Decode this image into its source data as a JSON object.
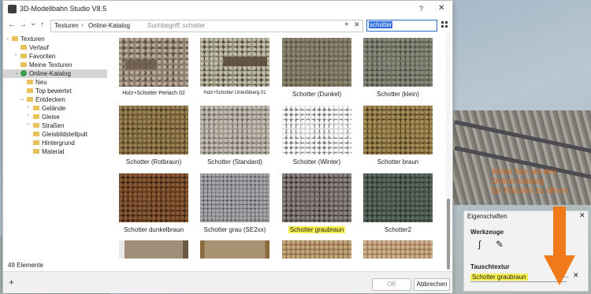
{
  "window": {
    "title": "3D-Modellbahn Studio V8.5",
    "help": "?",
    "close": "✕"
  },
  "toolbar": {
    "back": "←",
    "forward": "→",
    "dropdown": "⌄",
    "up": "↑",
    "breadcrumb": [
      "Texturen",
      "Online-Katalog"
    ],
    "separator": "›",
    "search_hint": "Suchbegriff: schotter",
    "add": "+",
    "clear": "✕",
    "search_value": "schotter"
  },
  "tree": {
    "items": [
      {
        "label": "Texturen",
        "level": 0,
        "expander": "⌄"
      },
      {
        "label": "Verlauf",
        "level": 1,
        "expander": ""
      },
      {
        "label": "Favoriten",
        "level": 1,
        "expander": "›"
      },
      {
        "label": "Meine Texturen",
        "level": 1,
        "expander": ""
      },
      {
        "label": "Online-Katalog",
        "level": 1,
        "expander": "⌄",
        "selected": true
      },
      {
        "label": "Neu",
        "level": 2,
        "expander": ""
      },
      {
        "label": "Top bewertet",
        "level": 2,
        "expander": ""
      },
      {
        "label": "Entdecken",
        "level": 2,
        "expander": "⌄"
      },
      {
        "label": "Gelände",
        "level": 3,
        "expander": "›"
      },
      {
        "label": "Gleise",
        "level": 3,
        "expander": "›"
      },
      {
        "label": "Straßen",
        "level": 3,
        "expander": "›"
      },
      {
        "label": "Gleisbildstellpult",
        "level": 3,
        "expander": ""
      },
      {
        "label": "Hintergrund",
        "level": 3,
        "expander": ""
      },
      {
        "label": "Material",
        "level": 3,
        "expander": ""
      }
    ]
  },
  "grid": {
    "tiles": [
      {
        "label": "Holz+Schotter Perlach 02"
      },
      {
        "label": "Holz+Schotter Unterbiberg 01"
      },
      {
        "label": "Schotter (Dunkel)"
      },
      {
        "label": "Schotter (klein)"
      },
      {
        "label": "Schotter (Rotbraun)"
      },
      {
        "label": "Schotter (Standard)"
      },
      {
        "label": "Schotter (Winter)"
      },
      {
        "label": "Schotter braun"
      },
      {
        "label": "Schotter dunkelbraun"
      },
      {
        "label": "Schotter grau (SE2xx)"
      },
      {
        "label": "Schotter graubraun",
        "highlight": true
      },
      {
        "label": "Schotter2"
      }
    ]
  },
  "status": {
    "count": "49 Elemente"
  },
  "bottom": {
    "add": "+",
    "ok": "OK",
    "cancel": "Abbrechen"
  },
  "properties": {
    "title": "Eigenschaften",
    "close": "✕",
    "tools_title": "Werkzeuge",
    "swap_title": "Tauschtextur",
    "swap_value": "Schotter graubraun",
    "dots": "...",
    "clear": "✕"
  },
  "callout": {
    "lines": [
      "Klicke hier um den",
      "Online-Katalog",
      "für Texturen zu öffnen"
    ]
  },
  "colors": {
    "accent": "#f07a1a",
    "highlight": "#f7ef4f",
    "selection": "#2f6fe0"
  }
}
